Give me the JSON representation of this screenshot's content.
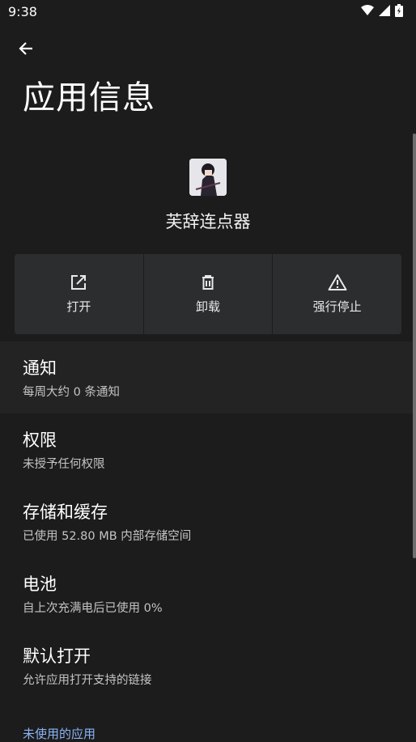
{
  "status": {
    "time": "9:38"
  },
  "header": {
    "title": "应用信息"
  },
  "app": {
    "name": "芙辞连点器"
  },
  "actions": [
    {
      "label": "打开",
      "icon": "open-external-icon"
    },
    {
      "label": "卸载",
      "icon": "trash-icon"
    },
    {
      "label": "强行停止",
      "icon": "warning-icon"
    }
  ],
  "settings": [
    {
      "title": "通知",
      "subtitle": "每周大约 0 条通知"
    },
    {
      "title": "权限",
      "subtitle": "未授予任何权限"
    },
    {
      "title": "存储和缓存",
      "subtitle": "已使用 52.80 MB 内部存储空间"
    },
    {
      "title": "电池",
      "subtitle": "自上次充满电后已使用 0%"
    },
    {
      "title": "默认打开",
      "subtitle": "允许应用打开支持的链接"
    }
  ],
  "section": {
    "unused_apps": "未使用的应用"
  },
  "colors": {
    "background": "#1c1c1c",
    "card": "#2c2d2f",
    "accent": "#8ab4f8"
  }
}
